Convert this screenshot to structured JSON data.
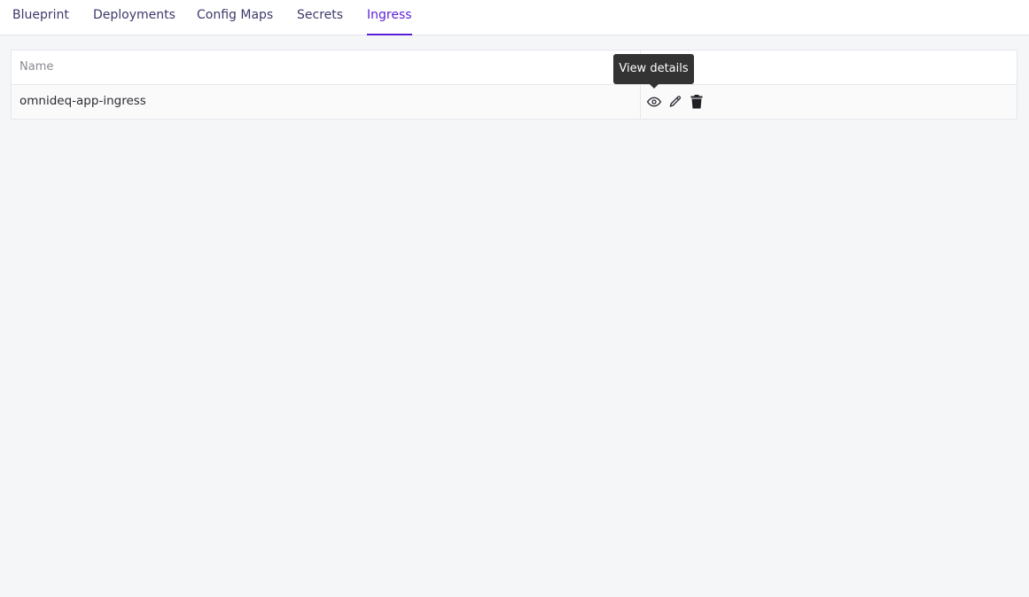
{
  "tabs": [
    {
      "label": "Blueprint",
      "active": false
    },
    {
      "label": "Deployments",
      "active": false
    },
    {
      "label": "Config Maps",
      "active": false
    },
    {
      "label": "Secrets",
      "active": false
    },
    {
      "label": "Ingress",
      "active": true
    }
  ],
  "table": {
    "columns": [
      "Name"
    ],
    "rows": [
      {
        "name": "omnideq-app-ingress",
        "actions": [
          "eye-icon",
          "pencil-icon",
          "trash-icon"
        ]
      }
    ]
  },
  "tooltip": {
    "text": "View details"
  },
  "colors": {
    "accent": "#5b1fd6",
    "tab_text": "#3d3a6b",
    "page_bg": "#f5f6f8",
    "tooltip_bg": "#333333"
  }
}
